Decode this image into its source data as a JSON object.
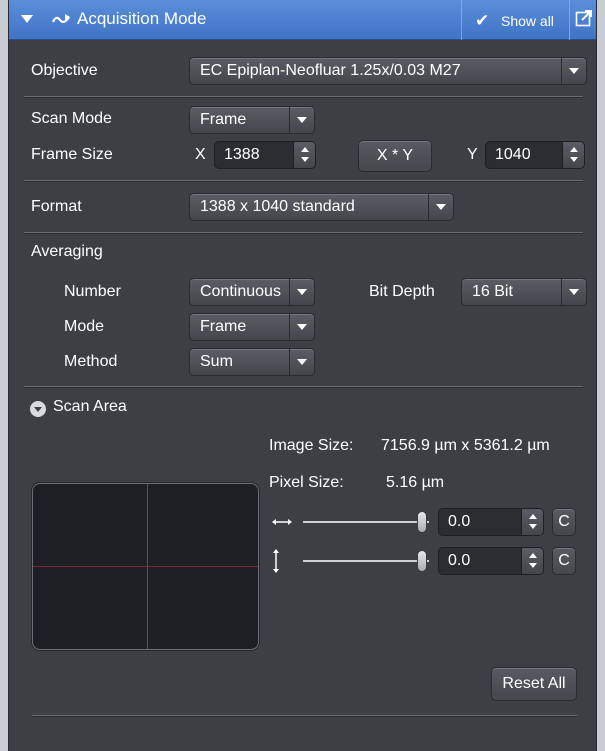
{
  "panel": {
    "title": "Acquisition Mode",
    "show_all_label": "Show all",
    "icons": [
      "collapse-triangle-icon",
      "acquisition-mode-icon",
      "checkmark-icon",
      "popout-icon"
    ]
  },
  "objective": {
    "label": "Objective",
    "value": "EC Epiplan-Neofluar 1.25x/0.03 M27"
  },
  "scan_mode": {
    "label": "Scan Mode",
    "value": "Frame"
  },
  "frame_size": {
    "label": "Frame Size",
    "x_label": "X",
    "x_value": "1388",
    "xy_button": "X * Y",
    "y_label": "Y",
    "y_value": "1040"
  },
  "format": {
    "label": "Format",
    "value": "1388 x 1040 standard"
  },
  "averaging": {
    "label": "Averaging",
    "number_label": "Number",
    "number_value": "Continuous",
    "bit_depth_label": "Bit Depth",
    "bit_depth_value": "16 Bit",
    "mode_label": "Mode",
    "mode_value": "Frame",
    "method_label": "Method",
    "method_value": "Sum"
  },
  "scan_area": {
    "label": "Scan Area",
    "image_size_label": "Image Size:",
    "image_size_value": "7156.9 µm x 5361.2 µm",
    "pixel_size_label": "Pixel Size:",
    "pixel_size_value": "5.16 µm",
    "horizontal_offset": "0.0",
    "vertical_offset": "0.0",
    "center_button": "C",
    "reset_button": "Reset All"
  },
  "colors": {
    "title_bar": "#4a82d2",
    "panel_bg": "#3d3f44",
    "preview_bg": "#1d1f24"
  }
}
